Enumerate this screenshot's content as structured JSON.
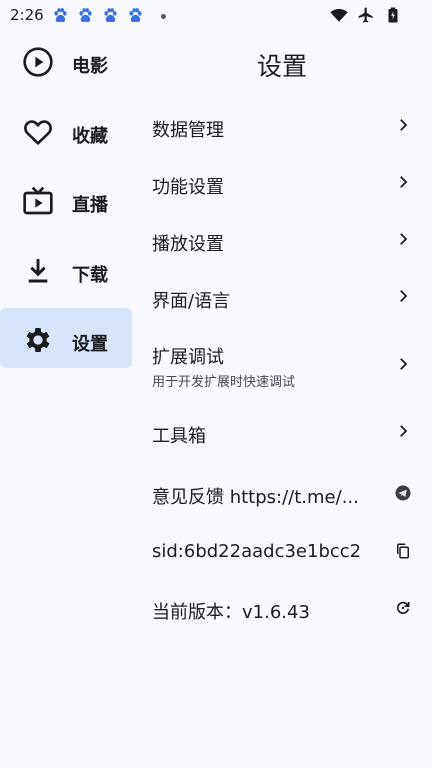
{
  "status_bar": {
    "time": "2:26",
    "icons": [
      "baidu-paw-icon",
      "baidu-paw-icon",
      "baidu-paw-icon",
      "baidu-paw-icon",
      "wifi-icon",
      "airplane-icon",
      "battery-icon"
    ]
  },
  "sidebar": {
    "items": [
      {
        "label": "电影",
        "icon": "play-circle-icon",
        "active": false
      },
      {
        "label": "收藏",
        "icon": "heart-icon",
        "active": false
      },
      {
        "label": "直播",
        "icon": "tv-icon",
        "active": false
      },
      {
        "label": "下载",
        "icon": "download-icon",
        "active": false
      },
      {
        "label": "设置",
        "icon": "gear-icon",
        "active": true
      }
    ]
  },
  "page": {
    "title": "设置"
  },
  "settings": {
    "items": [
      {
        "label": "数据管理",
        "icon": "chevron-right-icon"
      },
      {
        "label": "功能设置",
        "icon": "chevron-right-icon"
      },
      {
        "label": "播放设置",
        "icon": "chevron-right-icon"
      },
      {
        "label": "界面/语言",
        "icon": "chevron-right-icon"
      },
      {
        "label": "扩展调试",
        "subtitle": "用于开发扩展时快速调试",
        "icon": "chevron-right-icon"
      },
      {
        "label": "工具箱",
        "icon": "chevron-right-icon"
      },
      {
        "label": "意见反馈 https://t.me/...",
        "icon": "telegram-icon"
      },
      {
        "label": "sid:6bd22aadc3e1bcc2",
        "icon": "copy-icon"
      },
      {
        "label": "当前版本：v1.6.43",
        "icon": "refresh-icon"
      }
    ]
  },
  "colors": {
    "background": "#f7f9fe",
    "active_nav": "#d7e3f8",
    "text": "#1b1c20",
    "paw": "#3b6fe0"
  }
}
